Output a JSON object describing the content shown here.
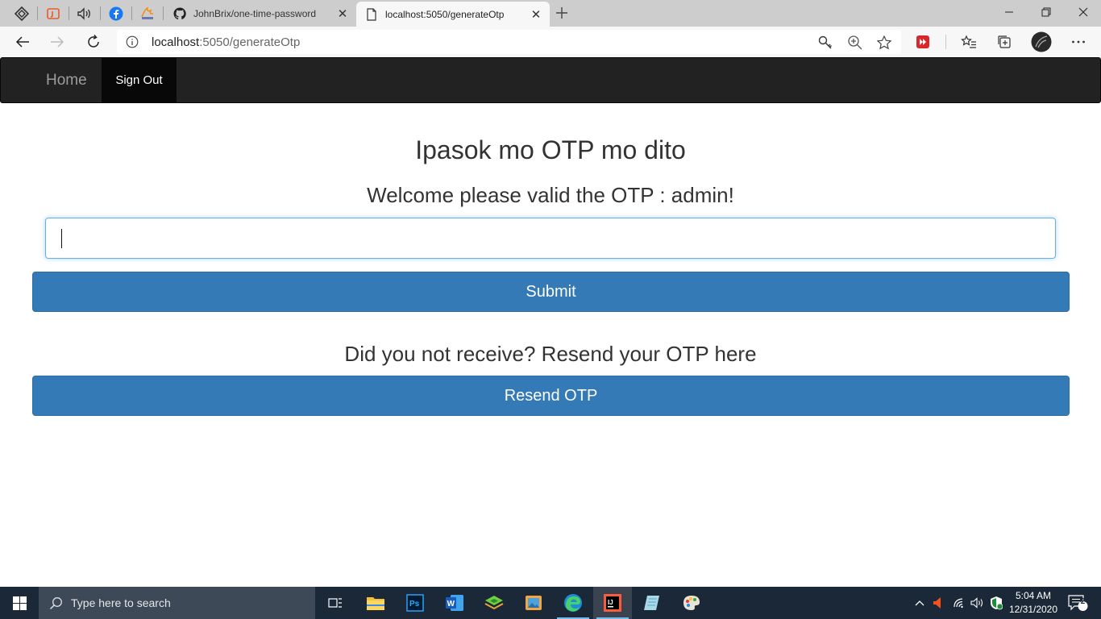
{
  "browser": {
    "tabs": [
      {
        "title": "JohnBrix/one-time-password",
        "favicon": "github-icon",
        "active": false
      },
      {
        "title": "localhost:5050/generateOtp",
        "favicon": "page-icon",
        "active": true
      }
    ],
    "address": {
      "host": "localhost",
      "path": ":5050/generateOtp"
    }
  },
  "navbar": {
    "home": "Home",
    "sign_out": "Sign Out"
  },
  "page": {
    "title": "Ipasok mo OTP mo dito",
    "welcome": "Welcome please valid the OTP : admin!",
    "otp_value": "",
    "submit": "Submit",
    "resend_prompt": "Did you not receive? Resend your OTP here",
    "resend": "Resend OTP"
  },
  "taskbar": {
    "search_placeholder": "Type here to search",
    "time": "5:04 AM",
    "date": "12/31/2020",
    "notification_count": "2"
  },
  "colors": {
    "primary_button": "#337ab7",
    "navbar_bg": "#222222",
    "taskbar_bg": "#1b2838"
  }
}
